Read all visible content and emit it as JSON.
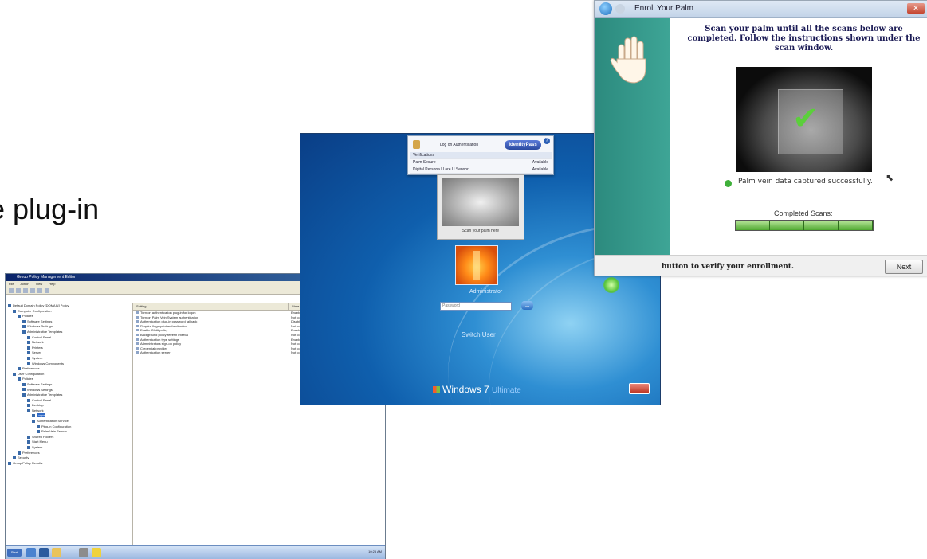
{
  "slide": {
    "caption": "e plug-in"
  },
  "palm_window": {
    "title": "Enroll Your Palm",
    "instructions": "Scan your palm until all the scans below are completed. Follow the instructions shown under the scan window.",
    "status": "Palm vein data captured successfully.",
    "completed_label": "Completed Scans:",
    "completed_fraction": 1.0,
    "footer": "button to verify your enrollment.",
    "next_label": "Next",
    "icons": [
      "back-arrow-icon",
      "hand-icon",
      "check-icon",
      "success-dot-icon",
      "pointer-cursor-icon"
    ]
  },
  "win7_logon": {
    "popup": {
      "title": "Log on Authentication",
      "logo": "IdentityPass",
      "help": "?",
      "header_col1": "Verifications",
      "header_col2": "",
      "rows": [
        {
          "name": "Palm Secure",
          "status": "Available"
        },
        {
          "name": "Digital Persona U.are.U Sensor",
          "status": "Available"
        }
      ]
    },
    "sensor_caption": "Scan your palm here",
    "username": "Administrator",
    "password_placeholder": "Password",
    "go_label": "→",
    "switch_user": "Switch User",
    "brand": "Windows 7",
    "edition": "Ultimate"
  },
  "gpmc_window": {
    "title": "Group Policy Management Editor",
    "menu": [
      "File",
      "Action",
      "View",
      "Help"
    ],
    "tree": [
      {
        "label": "Default Domain Policy [DOMAIN] Policy",
        "indent": 0
      },
      {
        "label": "Computer Configuration",
        "indent": 1
      },
      {
        "label": "Policies",
        "indent": 2
      },
      {
        "label": "Software Settings",
        "indent": 3
      },
      {
        "label": "Windows Settings",
        "indent": 3
      },
      {
        "label": "Administrative Templates",
        "indent": 3
      },
      {
        "label": "Control Panel",
        "indent": 4
      },
      {
        "label": "Network",
        "indent": 4
      },
      {
        "label": "Printers",
        "indent": 4
      },
      {
        "label": "Server",
        "indent": 4
      },
      {
        "label": "System",
        "indent": 4
      },
      {
        "label": "Windows Components",
        "indent": 4
      },
      {
        "label": "Preferences",
        "indent": 2
      },
      {
        "label": "User Configuration",
        "indent": 1
      },
      {
        "label": "Policies",
        "indent": 2
      },
      {
        "label": "Software Settings",
        "indent": 3
      },
      {
        "label": "Windows Settings",
        "indent": 3
      },
      {
        "label": "Administrative Templates",
        "indent": 3
      },
      {
        "label": "Control Panel",
        "indent": 4
      },
      {
        "label": "Desktop",
        "indent": 4
      },
      {
        "label": "Network",
        "indent": 4
      },
      {
        "label": "Logon",
        "indent": 5,
        "selected": true
      },
      {
        "label": "Authentication Service",
        "indent": 5
      },
      {
        "label": "Plug-in Configuration",
        "indent": 6
      },
      {
        "label": "Palm Vein Sensor",
        "indent": 6
      },
      {
        "label": "Shared Folders",
        "indent": 4
      },
      {
        "label": "Start Menu",
        "indent": 4
      },
      {
        "label": "System",
        "indent": 4
      },
      {
        "label": "Preferences",
        "indent": 2
      },
      {
        "label": "Security",
        "indent": 1
      },
      {
        "label": "Group Policy Results",
        "indent": 0
      }
    ],
    "columns": [
      "Setting",
      "State"
    ],
    "rows": [
      {
        "setting": "Turn on authentication plug-in for logon",
        "state": "Enabled"
      },
      {
        "setting": "Turn on Palm Vein System authentication",
        "state": "Not configured"
      },
      {
        "setting": "Authentication plug-in password fallback",
        "state": "Disabled"
      },
      {
        "setting": "Require fingerprint authentication",
        "state": "Not configured"
      },
      {
        "setting": "Enable GINA policy",
        "state": "Enabled"
      },
      {
        "setting": "Background policy refresh interval",
        "state": "Not configured"
      },
      {
        "setting": "Authentication type settings",
        "state": "Enabled"
      },
      {
        "setting": "Administrators sign-on policy",
        "state": "Not configured"
      },
      {
        "setting": "Credential provider",
        "state": "Not configured"
      },
      {
        "setting": "Authentication server",
        "state": "Not configured"
      }
    ],
    "start_label": "Start",
    "tray_time": "10:25 AM"
  }
}
